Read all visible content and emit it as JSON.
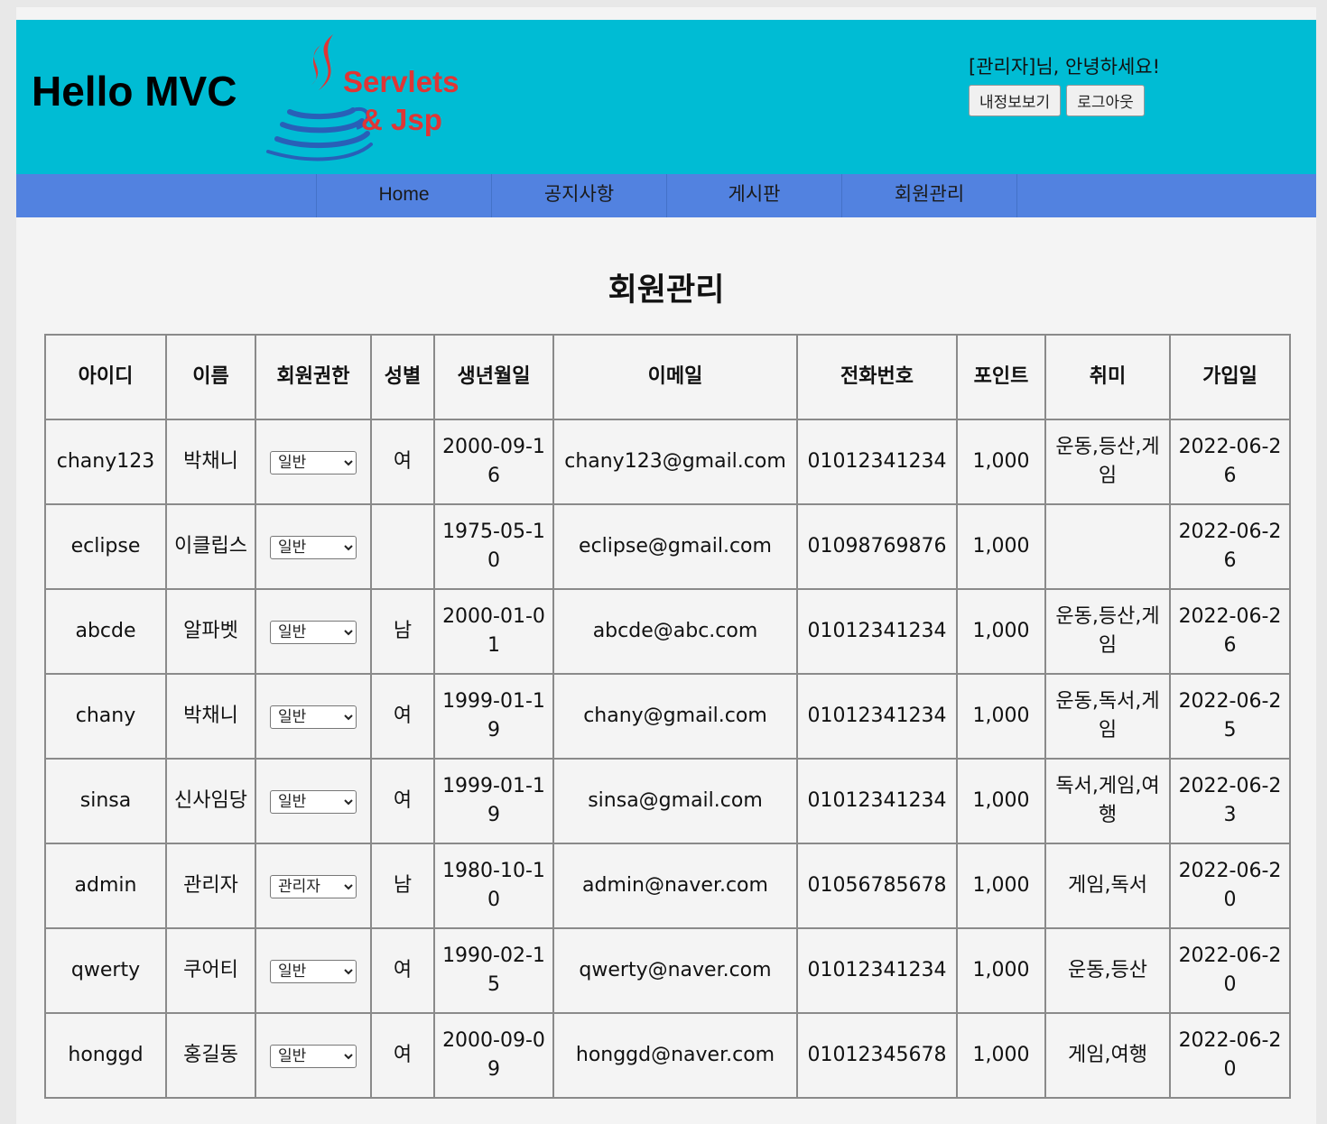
{
  "header": {
    "brand": "Hello MVC",
    "logo_line1": "Servlets",
    "logo_line2": "& Jsp",
    "greeting": "[관리자]님, 안녕하세요!",
    "myinfo_label": "내정보보기",
    "logout_label": "로그아웃"
  },
  "nav": {
    "items": [
      {
        "label": "Home"
      },
      {
        "label": "공지사항"
      },
      {
        "label": "게시판"
      },
      {
        "label": "회원관리"
      }
    ]
  },
  "main": {
    "title": "회원관리",
    "columns": [
      "아이디",
      "이름",
      "회원권한",
      "성별",
      "생년월일",
      "이메일",
      "전화번호",
      "포인트",
      "취미",
      "가입일"
    ],
    "rows": [
      {
        "id": "chany123",
        "name": "박채니",
        "role": "일반",
        "gender": "여",
        "birth": "2000-09-16",
        "email": "chany123@gmail.com",
        "phone": "01012341234",
        "point": "1,000",
        "hobby": "운동,등산,게임",
        "joined": "2022-06-26"
      },
      {
        "id": "eclipse",
        "name": "이클립스",
        "role": "일반",
        "gender": "",
        "birth": "1975-05-10",
        "email": "eclipse@gmail.com",
        "phone": "01098769876",
        "point": "1,000",
        "hobby": "",
        "joined": "2022-06-26"
      },
      {
        "id": "abcde",
        "name": "알파벳",
        "role": "일반",
        "gender": "남",
        "birth": "2000-01-01",
        "email": "abcde@abc.com",
        "phone": "01012341234",
        "point": "1,000",
        "hobby": "운동,등산,게임",
        "joined": "2022-06-26"
      },
      {
        "id": "chany",
        "name": "박채니",
        "role": "일반",
        "gender": "여",
        "birth": "1999-01-19",
        "email": "chany@gmail.com",
        "phone": "01012341234",
        "point": "1,000",
        "hobby": "운동,독서,게임",
        "joined": "2022-06-25"
      },
      {
        "id": "sinsa",
        "name": "신사임당",
        "role": "일반",
        "gender": "여",
        "birth": "1999-01-19",
        "email": "sinsa@gmail.com",
        "phone": "01012341234",
        "point": "1,000",
        "hobby": "독서,게임,여행",
        "joined": "2022-06-23"
      },
      {
        "id": "admin",
        "name": "관리자",
        "role": "관리자",
        "gender": "남",
        "birth": "1980-10-10",
        "email": "admin@naver.com",
        "phone": "01056785678",
        "point": "1,000",
        "hobby": "게임,독서",
        "joined": "2022-06-20"
      },
      {
        "id": "qwerty",
        "name": "쿠어티",
        "role": "일반",
        "gender": "여",
        "birth": "1990-02-15",
        "email": "qwerty@naver.com",
        "phone": "01012341234",
        "point": "1,000",
        "hobby": "운동,등산",
        "joined": "2022-06-20"
      },
      {
        "id": "honggd",
        "name": "홍길동",
        "role": "일반",
        "gender": "여",
        "birth": "2000-09-09",
        "email": "honggd@naver.com",
        "phone": "01012345678",
        "point": "1,000",
        "hobby": "게임,여행",
        "joined": "2022-06-20"
      }
    ]
  }
}
